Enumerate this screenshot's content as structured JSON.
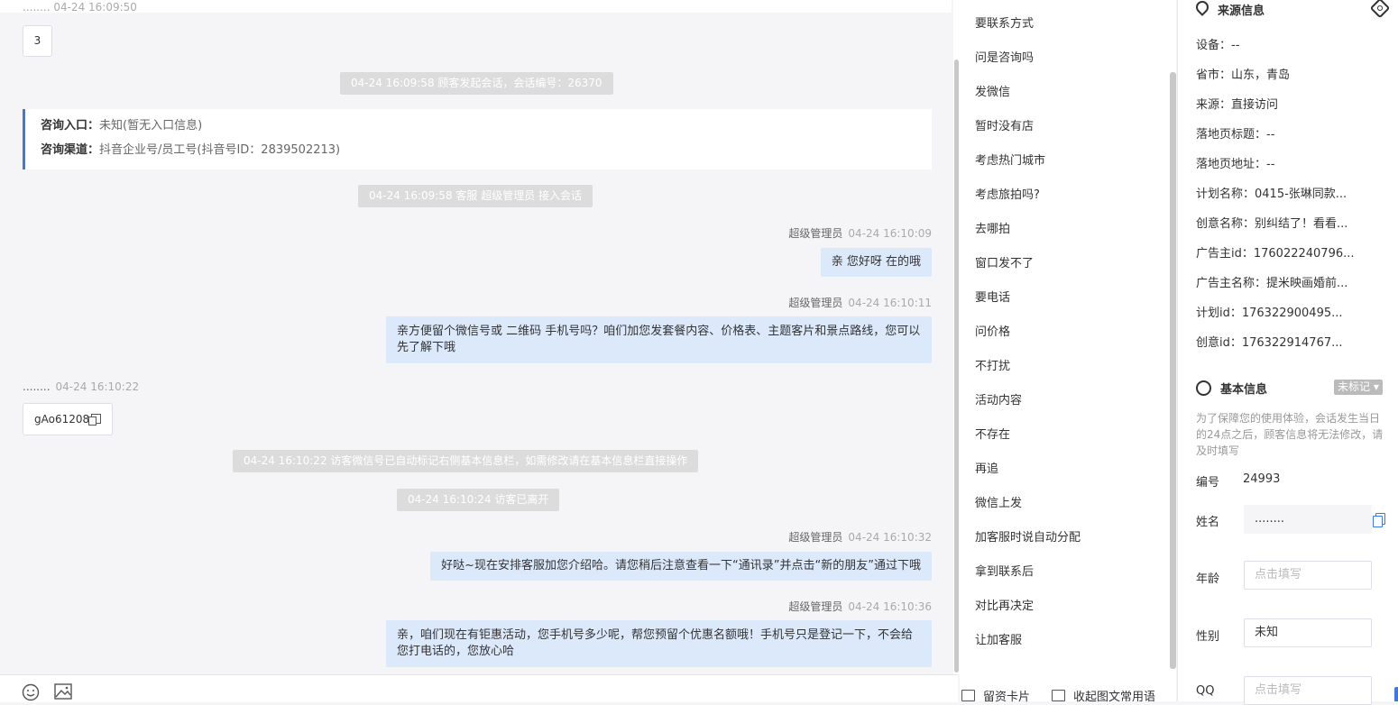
{
  "chat": {
    "top_cut_name": "........ 04-24 16:09:50",
    "number_reply": "3",
    "sys1": "04-24 16:09:58 顾客发起会话，会话编号：26370",
    "entry_label": "咨询入口：",
    "entry_value": "未知(暂无入口信息)",
    "channel_label": "咨询渠道：",
    "channel_value": "抖音企业号/员工号(抖音号ID：2839502213)",
    "sys2": "04-24 16:09:58 客服 超级管理员 接入会话",
    "msg1_sender": "超级管理员",
    "msg1_time": "04-24 16:10:09",
    "msg1_text": "亲 您好呀 在的哦",
    "msg2_sender": "超级管理员",
    "msg2_time": "04-24 16:10:11",
    "msg2_text": "亲方便留个微信号或 二维码 手机号吗？咱们加您发套餐内容、价格表、主题客片和景点路线，您可以先了解下哦",
    "visitor_name": "........",
    "visitor_time": "04-24 16:10:22",
    "visitor_text": "gAo61208",
    "sys3": "04-24 16:10:22 访客微信号已自动标记右侧基本信息栏，如需修改请在基本信息栏直接操作",
    "sys4": "04-24 16:10:24 访客已离开",
    "msg3_sender": "超级管理员",
    "msg3_time": "04-24 16:10:32",
    "msg3_text": "好哒~现在安排客服加您介绍哈。请您稍后注意查看一下“通讯录”并点击“新的朋友”通过下哦",
    "msg4_sender": "超级管理员",
    "msg4_time": "04-24 16:10:36",
    "msg4_text": "亲，咱们现在有钜惠活动，您手机号多少呢，帮您预留个优惠名额哦！手机号只是登记一下，不会给您打电话的，您放心哈"
  },
  "phrases": {
    "items": [
      "要联系方式",
      "问是咨询吗",
      "发微信",
      "暂时没有店",
      "考虑热门城市",
      "考虑旅拍吗?",
      "去哪拍",
      "窗口发不了",
      "要电话",
      "问价格",
      "不打扰",
      "活动内容",
      "不存在",
      "再追",
      "微信上发",
      "加客服时说自动分配",
      "拿到联系后",
      "对比再决定",
      "让加客服"
    ],
    "footer_card": "留资卡片",
    "footer_collapse": "收起图文常用语"
  },
  "panel": {
    "source_title": "来源信息",
    "source_rows": [
      "设备：--",
      "省市：山东，青岛",
      "来源：直接访问",
      "落地页标题：--",
      "落地页地址：--",
      "计划名称：0415-张琳同款...",
      "创意名称：别纠结了！看看...",
      "广告主id：176022240796...",
      "广告主名称：提米映画婚前...",
      "计划id：176322900495...",
      "创意id：176322914767..."
    ],
    "basic_title": "基本信息",
    "badge": "未标记",
    "note": "为了保障您的使用体验，会话发生当日的24点之后，顾客信息将无法修改，请及时填写",
    "id_label": "编号",
    "id_value": "24993",
    "name_label": "姓名",
    "name_value": "........",
    "age_label": "年龄",
    "age_placeholder": "点击填写",
    "gender_label": "性别",
    "gender_value": "未知",
    "qq_label": "QQ",
    "qq_placeholder": "点击填写"
  },
  "icons": {
    "emoji": "emoji-icon",
    "image": "image-icon"
  }
}
